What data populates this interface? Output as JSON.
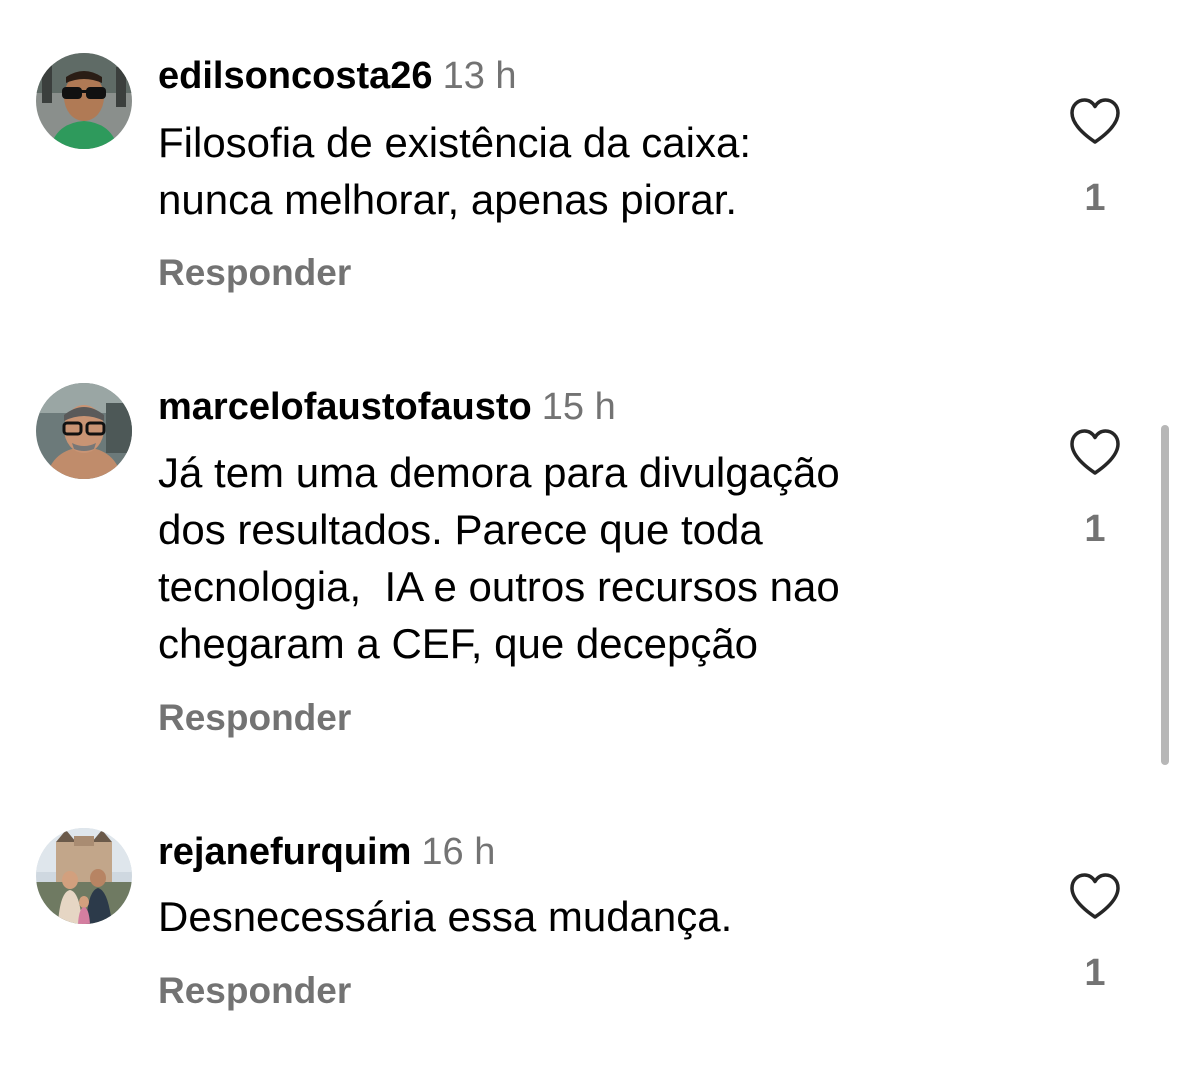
{
  "comments": [
    {
      "username": "edilsoncosta26",
      "time": "13 h",
      "text": "Filosofia de existência da caixa:\nnunca melhorar, apenas piorar.",
      "reply_label": "Responder",
      "like_count": "1",
      "avatar_icon": "profile-photo-man-sunglasses"
    },
    {
      "username": "marcelofaustofausto",
      "time": "15 h",
      "text": "Já tem uma demora para divulgação\ndos resultados. Parece que toda\ntecnologia,  IA e outros recursos nao\nchegaram a CEF, que decepção",
      "reply_label": "Responder",
      "like_count": "1",
      "avatar_icon": "profile-photo-man-glasses"
    },
    {
      "username": "rejanefurquim",
      "time": "16 h",
      "text": "Desnecessária essa mudança.",
      "reply_label": "Responder",
      "like_count": "1",
      "avatar_icon": "profile-photo-family-castle"
    }
  ],
  "colors": {
    "text": "#000000",
    "secondary": "#737373",
    "scrollbar": "#b7b7b7",
    "heart_outline": "#262626"
  }
}
